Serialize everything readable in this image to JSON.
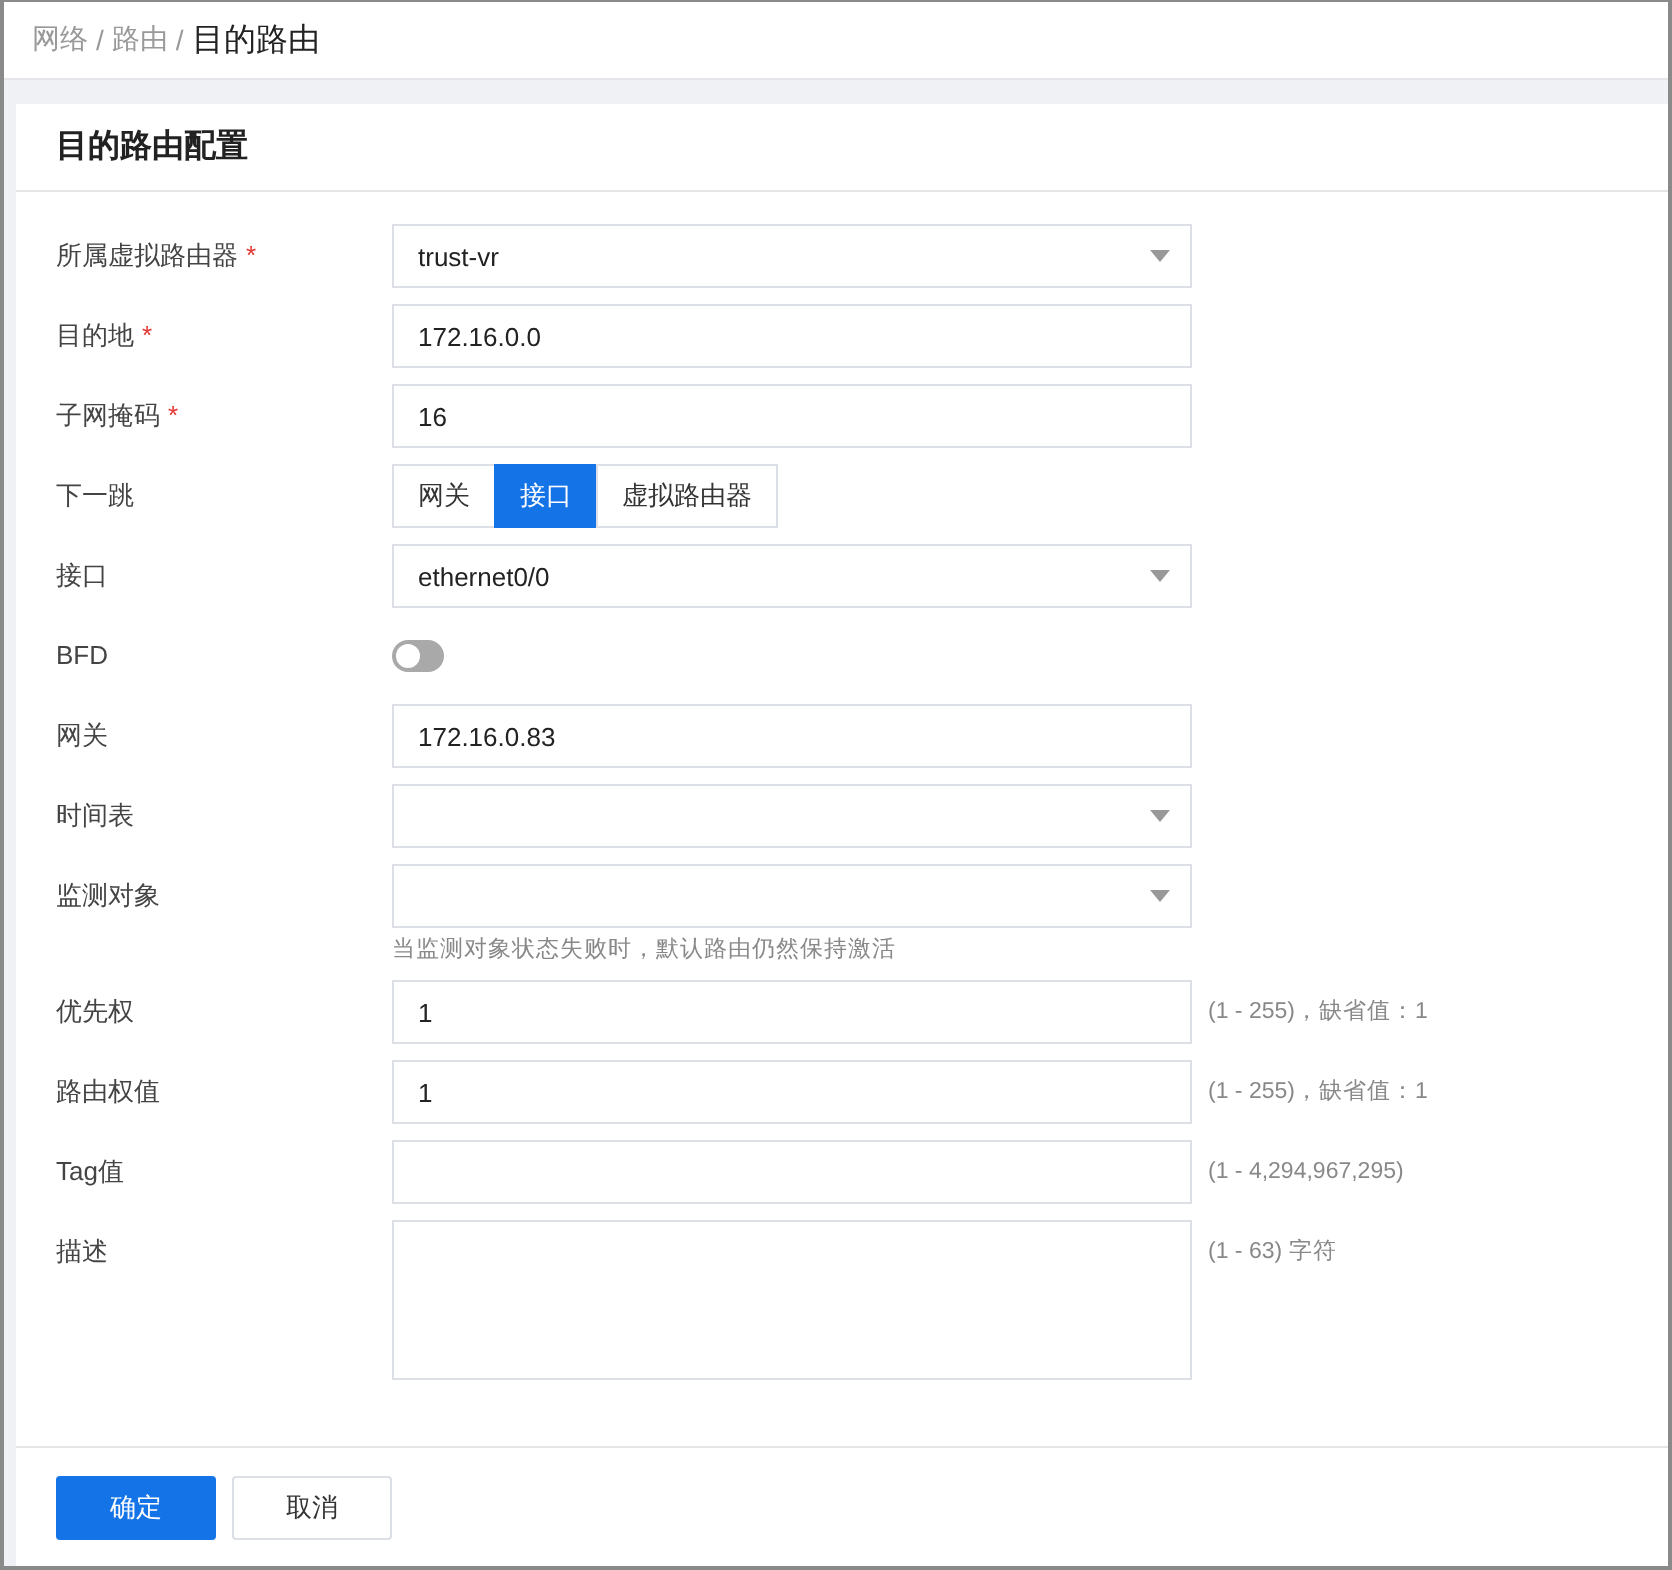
{
  "breadcrumb": [
    {
      "label": "网络",
      "current": false
    },
    {
      "label": "路由",
      "current": false
    },
    {
      "label": "目的路由",
      "current": true
    }
  ],
  "separator": "/",
  "card": {
    "title": "目的路由配置"
  },
  "fields": [
    {
      "kind": "select",
      "label": "所属虚拟路由器",
      "required": true,
      "value": "trust-vr"
    },
    {
      "kind": "text",
      "label": "目的地",
      "required": true,
      "value": "172.16.0.0"
    },
    {
      "kind": "text",
      "label": "子网掩码",
      "required": true,
      "value": "16"
    },
    {
      "kind": "segmented",
      "label": "下一跳",
      "required": false,
      "options": [
        {
          "label": "网关",
          "selected": false
        },
        {
          "label": "接口",
          "selected": true
        },
        {
          "label": "虚拟路由器",
          "selected": false
        }
      ]
    },
    {
      "kind": "select",
      "label": "接口",
      "required": false,
      "value": "ethernet0/0"
    },
    {
      "kind": "switch",
      "label": "BFD",
      "required": false,
      "on": false
    },
    {
      "kind": "text",
      "label": "网关",
      "required": false,
      "value": "172.16.0.83"
    },
    {
      "kind": "select",
      "label": "时间表",
      "required": false
    },
    {
      "kind": "select",
      "label": "监测对象",
      "required": false,
      "help": "当监测对象状态失败时，默认路由仍然保持激活"
    },
    {
      "kind": "text",
      "label": "优先权",
      "required": false,
      "value": "1",
      "hint": "(1 - 255)，缺省值：1"
    },
    {
      "kind": "text",
      "label": "路由权值",
      "required": false,
      "value": "1",
      "hint": "(1 - 255)，缺省值：1"
    },
    {
      "kind": "text",
      "label": "Tag值",
      "required": false,
      "hint": "(1 - 4,294,967,295)"
    },
    {
      "kind": "textarea",
      "label": "描述",
      "required": false,
      "hint": "(1 - 63) 字符"
    }
  ],
  "required_mark": "*",
  "buttons": [
    {
      "label": "确定",
      "primary": true
    },
    {
      "label": "取消",
      "primary": false
    }
  ]
}
